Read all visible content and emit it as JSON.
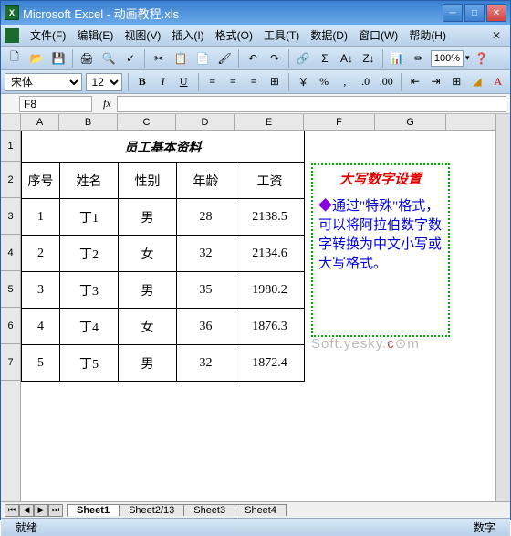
{
  "window": {
    "title": "Microsoft Excel - 动画教程.xls"
  },
  "menus": [
    "文件(F)",
    "编辑(E)",
    "视图(V)",
    "插入(I)",
    "格式(O)",
    "工具(T)",
    "数据(D)",
    "窗口(W)",
    "帮助(H)"
  ],
  "toolbar": {
    "zoom": "100%"
  },
  "format": {
    "font": "宋体",
    "size": "12"
  },
  "namebox": "F8",
  "formula": "",
  "columns": [
    "A",
    "B",
    "C",
    "D",
    "E",
    "F",
    "G"
  ],
  "rows": [
    "1",
    "2",
    "3",
    "4",
    "5",
    "6",
    "7"
  ],
  "sheet": {
    "title": "员工基本资料",
    "headers": [
      "序号",
      "姓名",
      "性别",
      "年龄",
      "工资"
    ],
    "data": [
      {
        "no": "1",
        "name": "丁1",
        "sex": "男",
        "age": "28",
        "salary": "2138.5"
      },
      {
        "no": "2",
        "name": "丁2",
        "sex": "女",
        "age": "32",
        "salary": "2134.6"
      },
      {
        "no": "3",
        "name": "丁3",
        "sex": "男",
        "age": "35",
        "salary": "1980.2"
      },
      {
        "no": "4",
        "name": "丁4",
        "sex": "女",
        "age": "36",
        "salary": "1876.3"
      },
      {
        "no": "5",
        "name": "丁5",
        "sex": "男",
        "age": "32",
        "salary": "1872.4"
      }
    ]
  },
  "note": {
    "title": "大写数字设置",
    "body": "通过\"特殊\"格式，可以将阿拉伯数字数字转换为中文小写或大写格式。"
  },
  "watermark": {
    "prefix": "Soft.yesky.",
    "suffix": "m",
    "c": "c"
  },
  "tabs": [
    "Sheet1",
    "Sheet2/13",
    "Sheet3",
    "Sheet4"
  ],
  "active_tab": 0,
  "status": {
    "left": "就绪",
    "right": "数字"
  }
}
